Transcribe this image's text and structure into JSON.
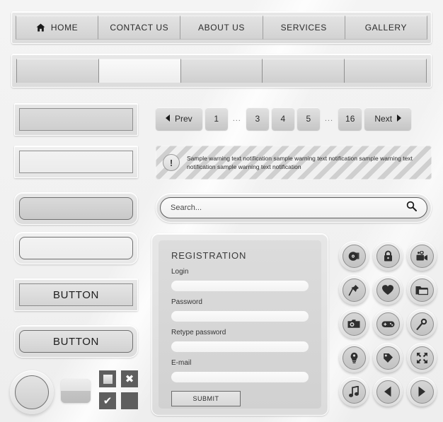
{
  "nav": {
    "items": [
      {
        "label": "HOME",
        "icon": "home-icon",
        "has_icon": true
      },
      {
        "label": "CONTACT US",
        "icon": "",
        "has_icon": false
      },
      {
        "label": "ABOUT US",
        "icon": "",
        "has_icon": false
      },
      {
        "label": "SERVICES",
        "icon": "",
        "has_icon": false
      },
      {
        "label": "GALLERY",
        "icon": "",
        "has_icon": false
      }
    ]
  },
  "segmented_bar": {
    "cells": [
      "",
      "",
      "",
      "",
      ""
    ],
    "active_index": 1
  },
  "left_controls": {
    "field_square_filled": {
      "label": ""
    },
    "field_square_light": {
      "label": ""
    },
    "field_round_filled": {
      "label": ""
    },
    "field_round_light": {
      "label": ""
    },
    "button_square_label": "BUTTON",
    "button_round_label": "BUTTON",
    "knob": {
      "label": ""
    },
    "toggle": {
      "label": ""
    },
    "checkboxes": [
      {
        "name": "checkbox-square",
        "glyph": ""
      },
      {
        "name": "checkbox-close",
        "glyph": "✖"
      },
      {
        "name": "checkbox-check",
        "glyph": "✔"
      },
      {
        "name": "checkbox-empty",
        "glyph": ""
      }
    ]
  },
  "pagination": {
    "prev_label": "Prev",
    "next_label": "Next",
    "prev_icon": "chevron-left-icon",
    "next_icon": "chevron-right-icon",
    "gap_label": "...",
    "pages": [
      "1",
      "3",
      "4",
      "5",
      "16"
    ]
  },
  "warning": {
    "icon": "exclamation-icon",
    "icon_glyph": "!",
    "text": "Sample warning text notification sample warning text notification sample warning text notification sample warning text notification"
  },
  "search": {
    "placeholder": "Search...",
    "value": "",
    "icon": "search-icon"
  },
  "registration": {
    "title": "REGISTRATION",
    "fields": [
      {
        "label": "Login",
        "value": "",
        "placeholder": ""
      },
      {
        "label": "Password",
        "value": "",
        "placeholder": ""
      },
      {
        "label": "Retype password",
        "value": "",
        "placeholder": ""
      },
      {
        "label": "E-mail",
        "value": "",
        "placeholder": ""
      }
    ],
    "submit_label": "SUBMIT"
  },
  "icon_grid": {
    "icons": [
      {
        "name": "disc-icon"
      },
      {
        "name": "lock-icon"
      },
      {
        "name": "video-camera-icon"
      },
      {
        "name": "pushpin-icon"
      },
      {
        "name": "heart-icon"
      },
      {
        "name": "folder-icon"
      },
      {
        "name": "camera-icon"
      },
      {
        "name": "gamepad-icon"
      },
      {
        "name": "microphone-icon"
      },
      {
        "name": "lightbulb-icon"
      },
      {
        "name": "tag-icon"
      },
      {
        "name": "fullscreen-icon"
      },
      {
        "name": "music-note-icon"
      },
      {
        "name": "arrow-left-icon"
      },
      {
        "name": "arrow-right-icon"
      }
    ]
  },
  "colors": {
    "background": "#f2f2f2",
    "plate": "#e2e2e2",
    "text": "#2b2b2b",
    "border_dark": "#8e8e8e",
    "checkbox_fill": "#5e5e5e"
  }
}
